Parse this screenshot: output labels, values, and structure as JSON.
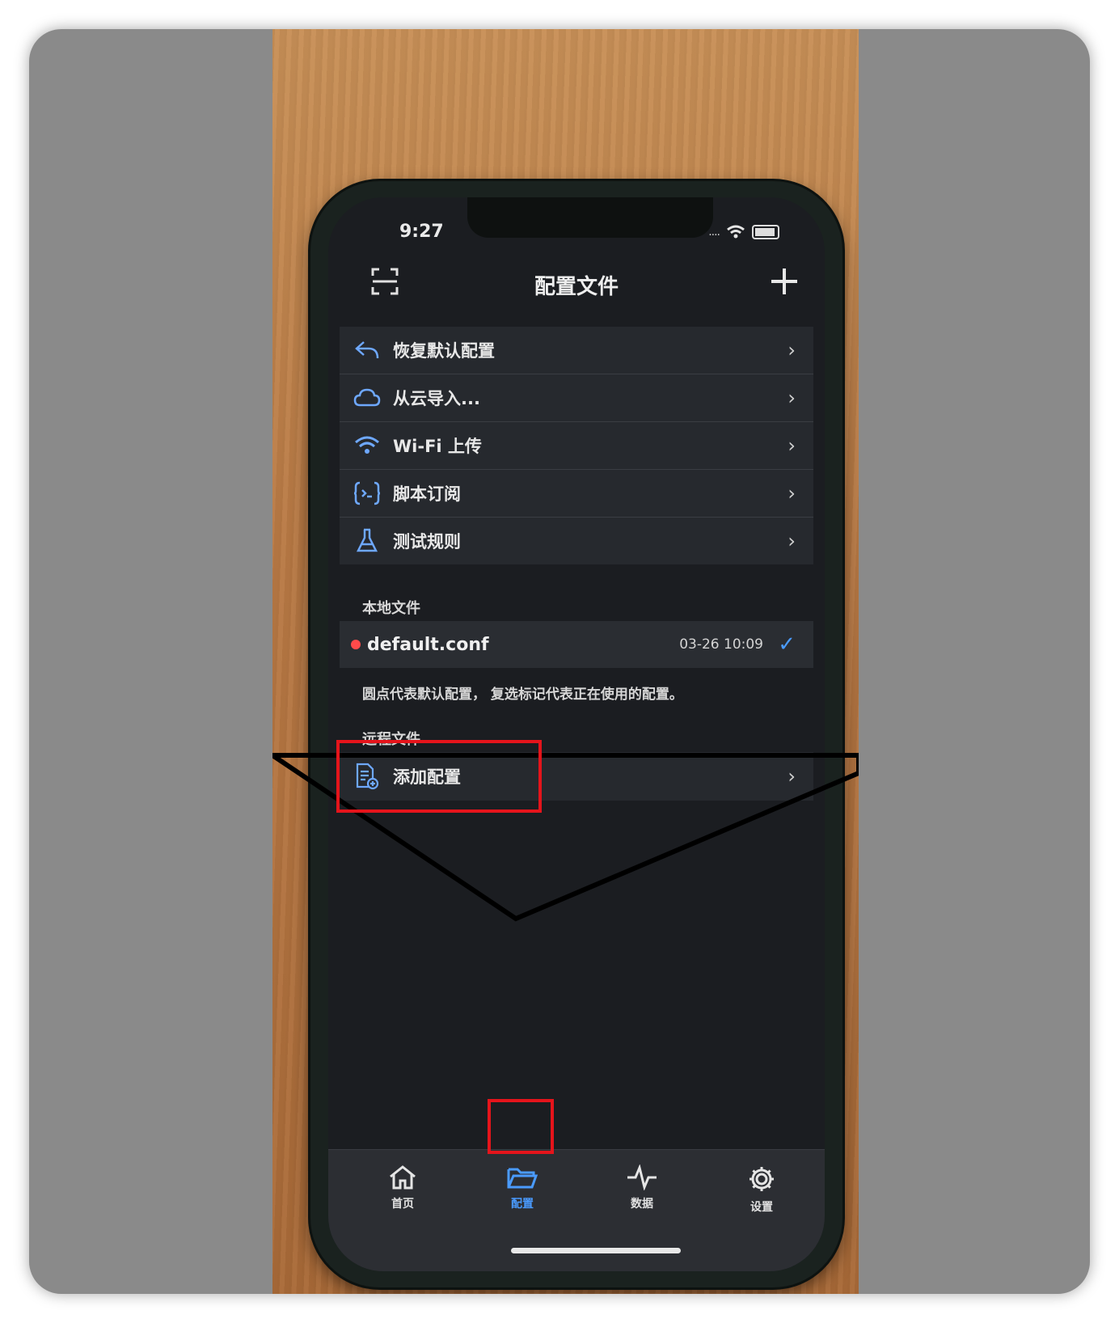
{
  "status_bar": {
    "time": "9:27",
    "signal": "....",
    "wifi_icon": "wifi-icon",
    "battery_icon": "battery-icon"
  },
  "nav": {
    "title": "配置文件",
    "left_icon": "scan-icon",
    "right_icon": "plus-icon"
  },
  "menu": {
    "items": [
      {
        "label": "恢复默认配置",
        "icon": "undo-icon"
      },
      {
        "label": "从云导入...",
        "icon": "cloud-icon"
      },
      {
        "label": "Wi-Fi 上传",
        "icon": "wifi-icon"
      },
      {
        "label": "脚本订阅",
        "icon": "script-icon"
      },
      {
        "label": "测试规则",
        "icon": "flask-icon"
      }
    ],
    "chevron": "›"
  },
  "local": {
    "header": "本地文件",
    "file": {
      "name": "default.conf",
      "time": "03-26 10:09",
      "check": "✓"
    },
    "hint": "圆点代表默认配置， 复选标记代表正在使用的配置。"
  },
  "remote": {
    "header": "远程文件",
    "add_label": "添加配置"
  },
  "tabbar": {
    "tabs": [
      {
        "label": "首页",
        "icon": "home-icon"
      },
      {
        "label": "配置",
        "icon": "folder-icon"
      },
      {
        "label": "数据",
        "icon": "activity-icon"
      },
      {
        "label": "设置",
        "icon": "gear-icon"
      }
    ]
  },
  "colors": {
    "accent": "#4a9bff",
    "highlight": "#e5141b",
    "default_dot": "#ff4a4a"
  }
}
